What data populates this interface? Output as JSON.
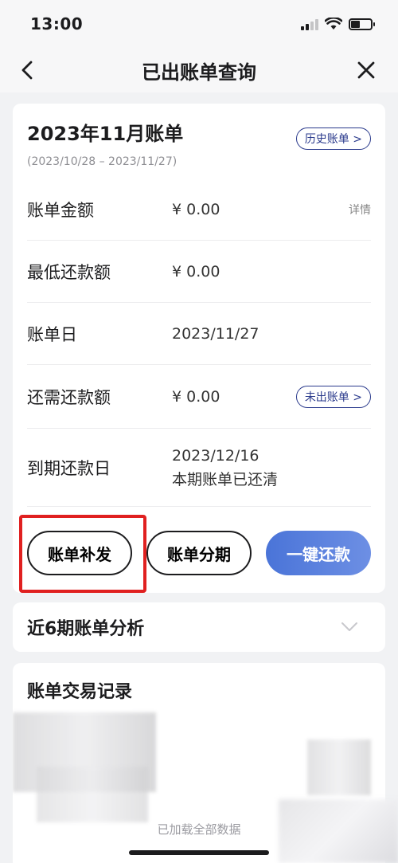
{
  "status_bar": {
    "time": "13:00"
  },
  "nav": {
    "title": "已出账单查询"
  },
  "bill": {
    "title": "2023年11月账单",
    "date_range": "(2023/10/28 – 2023/11/27)",
    "history_label": "历史账单 >",
    "rows": [
      {
        "label": "账单金额",
        "value": "¥ 0.00",
        "extra": "详情"
      },
      {
        "label": "最低还款额",
        "value": "¥ 0.00"
      },
      {
        "label": "账单日",
        "value": "2023/11/27"
      },
      {
        "label": "还需还款额",
        "value": "¥ 0.00",
        "extra": "未出账单 >"
      },
      {
        "label": "到期还款日",
        "value": "2023/12/16",
        "value2": "本期账单已还清"
      }
    ],
    "actions": {
      "reissue": "账单补发",
      "installment": "账单分期",
      "repay": "一键还款"
    }
  },
  "analysis": {
    "title": "近6期账单分析"
  },
  "records": {
    "title": "账单交易记录"
  },
  "footer": {
    "text": "已加载全部数据"
  },
  "colors": {
    "accent": "#2a3a8c",
    "primary_button": "#5a7fdd",
    "highlight": "#e02020"
  }
}
